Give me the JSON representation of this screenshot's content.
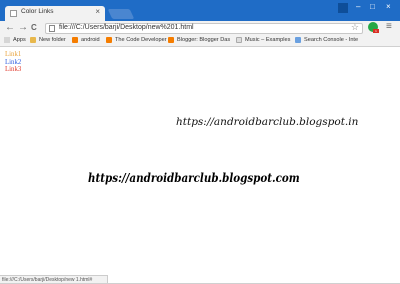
{
  "tab": {
    "title": "Color Links",
    "close_glyph": "×"
  },
  "window": {
    "minimize": "–",
    "maximize": "□",
    "close": "×"
  },
  "toolbar": {
    "back": "←",
    "forward": "→",
    "reload": "C",
    "url": "file:///C:/Users/barji/Desktop/new%201.html",
    "star": "☆",
    "menu": "≡",
    "extension_badge": "1"
  },
  "bookmarks": [
    {
      "label": "Apps",
      "icon": "apps-icon"
    },
    {
      "label": "New folder",
      "icon": "folder-icon"
    },
    {
      "label": "android",
      "icon": "blogger-icon"
    },
    {
      "label": "The Code Developer",
      "icon": "blogger-icon"
    },
    {
      "label": "Blogger: Blogger Das",
      "icon": "blogger-icon"
    },
    {
      "label": "Music – Examples",
      "icon": "page-icon"
    },
    {
      "label": "Search Console - Inte",
      "icon": "search-console-icon"
    }
  ],
  "links": [
    {
      "label": "Link1",
      "color": "#e8a33c"
    },
    {
      "label": "Link2",
      "color": "#2f5de0"
    },
    {
      "label": "Link3",
      "color": "#e0382b"
    }
  ],
  "watermarks": {
    "url_small": "https://androidbarclub.blogspot.in",
    "url_large": "https://androidbarclub.blogspot.com"
  },
  "status_bar": "file:///C:/Users/barji/Desktop/new 1.html#"
}
